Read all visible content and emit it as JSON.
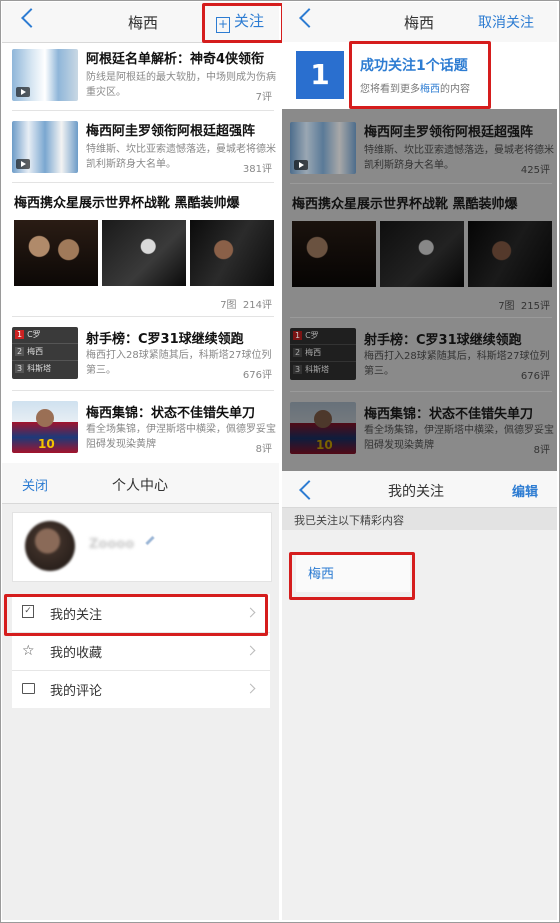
{
  "left": {
    "title": "梅西",
    "follow_label": "关注",
    "news": [
      {
        "title": "阿根廷名单解析：神奇4侠领衔",
        "desc": "防线是阿根廷的最大软肋，中场则成为伤病重灾区。",
        "count": "7评"
      },
      {
        "title": "梅西阿圭罗领衔阿根廷超强阵",
        "desc": "特维斯、坎比亚索遗憾落选，曼城老将德米凯利斯跻身大名单。",
        "count": "381评"
      }
    ],
    "gallery": {
      "title": "梅西携众星展示世界杯战靴 黑酷装帅爆",
      "meta": "7图  214评"
    },
    "news2": [
      {
        "title": "射手榜：C罗31球继续领跑",
        "desc": "梅西打入28球紧随其后，科斯塔27球位列第三。",
        "count": "676评",
        "rank": [
          {
            "no": "1",
            "name": "C罗"
          },
          {
            "no": "2",
            "name": "梅西"
          },
          {
            "no": "3",
            "name": "科斯塔"
          }
        ]
      },
      {
        "title": "梅西集锦：状态不佳错失单刀",
        "desc": "看全场集锦，伊涅斯塔中横梁，佩德罗妥宝阻碍发现染黄牌",
        "count": "8评"
      }
    ]
  },
  "right": {
    "title": "梅西",
    "unfollow_label": "取消关注",
    "toast": {
      "number": "1",
      "title": "成功关注1个话题",
      "sub_prefix": "您将看到更多",
      "sub_link": "梅西",
      "sub_suffix": "的内容"
    },
    "news": [
      {
        "title": "梅西阿圭罗领衔阿根廷超强阵",
        "desc": "特维斯、坎比亚索遗憾落选，曼城老将德米凯利斯跻身大名单。",
        "count": "425评"
      }
    ],
    "gallery": {
      "title": "梅西携众星展示世界杯战靴 黑酷装帅爆",
      "meta": "7图  215评"
    },
    "news2": [
      {
        "title": "射手榜：C罗31球继续领跑",
        "desc": "梅西打入28球紧随其后，科斯塔27球位列第三。",
        "count": "676评",
        "rank": [
          {
            "no": "1",
            "name": "C罗"
          },
          {
            "no": "2",
            "name": "梅西"
          },
          {
            "no": "3",
            "name": "科斯塔"
          }
        ]
      },
      {
        "title": "梅西集锦：状态不佳错失单刀",
        "desc": "看全场集锦，伊涅斯塔中横梁，佩德罗妥宝阻碍发现染黄牌",
        "count": "8评"
      }
    ]
  },
  "profile": {
    "close_label": "关闭",
    "title": "个人中心",
    "username": "Zoooo",
    "menu": [
      "我的关注",
      "我的收藏",
      "我的评论"
    ]
  },
  "follows": {
    "title": "我的关注",
    "edit_label": "编辑",
    "subheader": "我已关注以下精彩内容",
    "tag": "梅西"
  },
  "colors": {
    "accent": "#2d7cd2",
    "highlight": "#d51d1d"
  }
}
